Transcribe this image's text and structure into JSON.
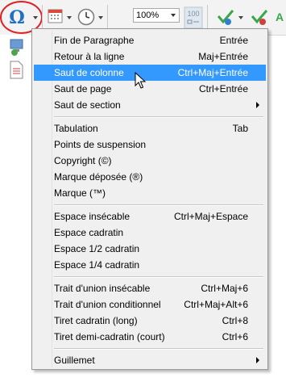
{
  "toolbar": {
    "zoom": "100%",
    "mode_label": "100"
  },
  "menu": {
    "items": [
      {
        "label": "Fin de Paragraphe",
        "shortcut": "Entrée"
      },
      {
        "label": "Retour à la ligne",
        "shortcut": "Maj+Entrée"
      },
      {
        "label": "Saut de colonne",
        "shortcut": "Ctrl+Maj+Entrée"
      },
      {
        "label": "Saut de page",
        "shortcut": "Ctrl+Entrée"
      },
      {
        "label": "Saut de section",
        "shortcut": ""
      },
      {
        "label": "Tabulation",
        "shortcut": "Tab"
      },
      {
        "label": "Points de suspension",
        "shortcut": ""
      },
      {
        "label": "Copyright (©)",
        "shortcut": ""
      },
      {
        "label": "Marque déposée (®)",
        "shortcut": ""
      },
      {
        "label": "Marque (™)",
        "shortcut": ""
      },
      {
        "label": "Espace insécable",
        "shortcut": "Ctrl+Maj+Espace"
      },
      {
        "label": "Espace cadratin",
        "shortcut": ""
      },
      {
        "label": "Espace 1/2 cadratin",
        "shortcut": ""
      },
      {
        "label": "Espace 1/4 cadratin",
        "shortcut": ""
      },
      {
        "label": "Trait d'union insécable",
        "shortcut": "Ctrl+Maj+6"
      },
      {
        "label": "Trait d'union conditionnel",
        "shortcut": "Ctrl+Maj+Alt+6"
      },
      {
        "label": "Tiret cadratin (long)",
        "shortcut": "Ctrl+8"
      },
      {
        "label": "Tiret demi-cadratin (court)",
        "shortcut": "Ctrl+6"
      },
      {
        "label": "Guillemet",
        "shortcut": ""
      }
    ]
  },
  "icons": {
    "symbol": "omega-icon",
    "date": "calendar-icon",
    "time": "clock-icon",
    "spell": "spellcheck-icon",
    "submenu": "chevron-right-icon"
  },
  "colors": {
    "highlight": "#3399ff",
    "menu_bg": "#f0f0f0",
    "circle": "#e02020"
  }
}
